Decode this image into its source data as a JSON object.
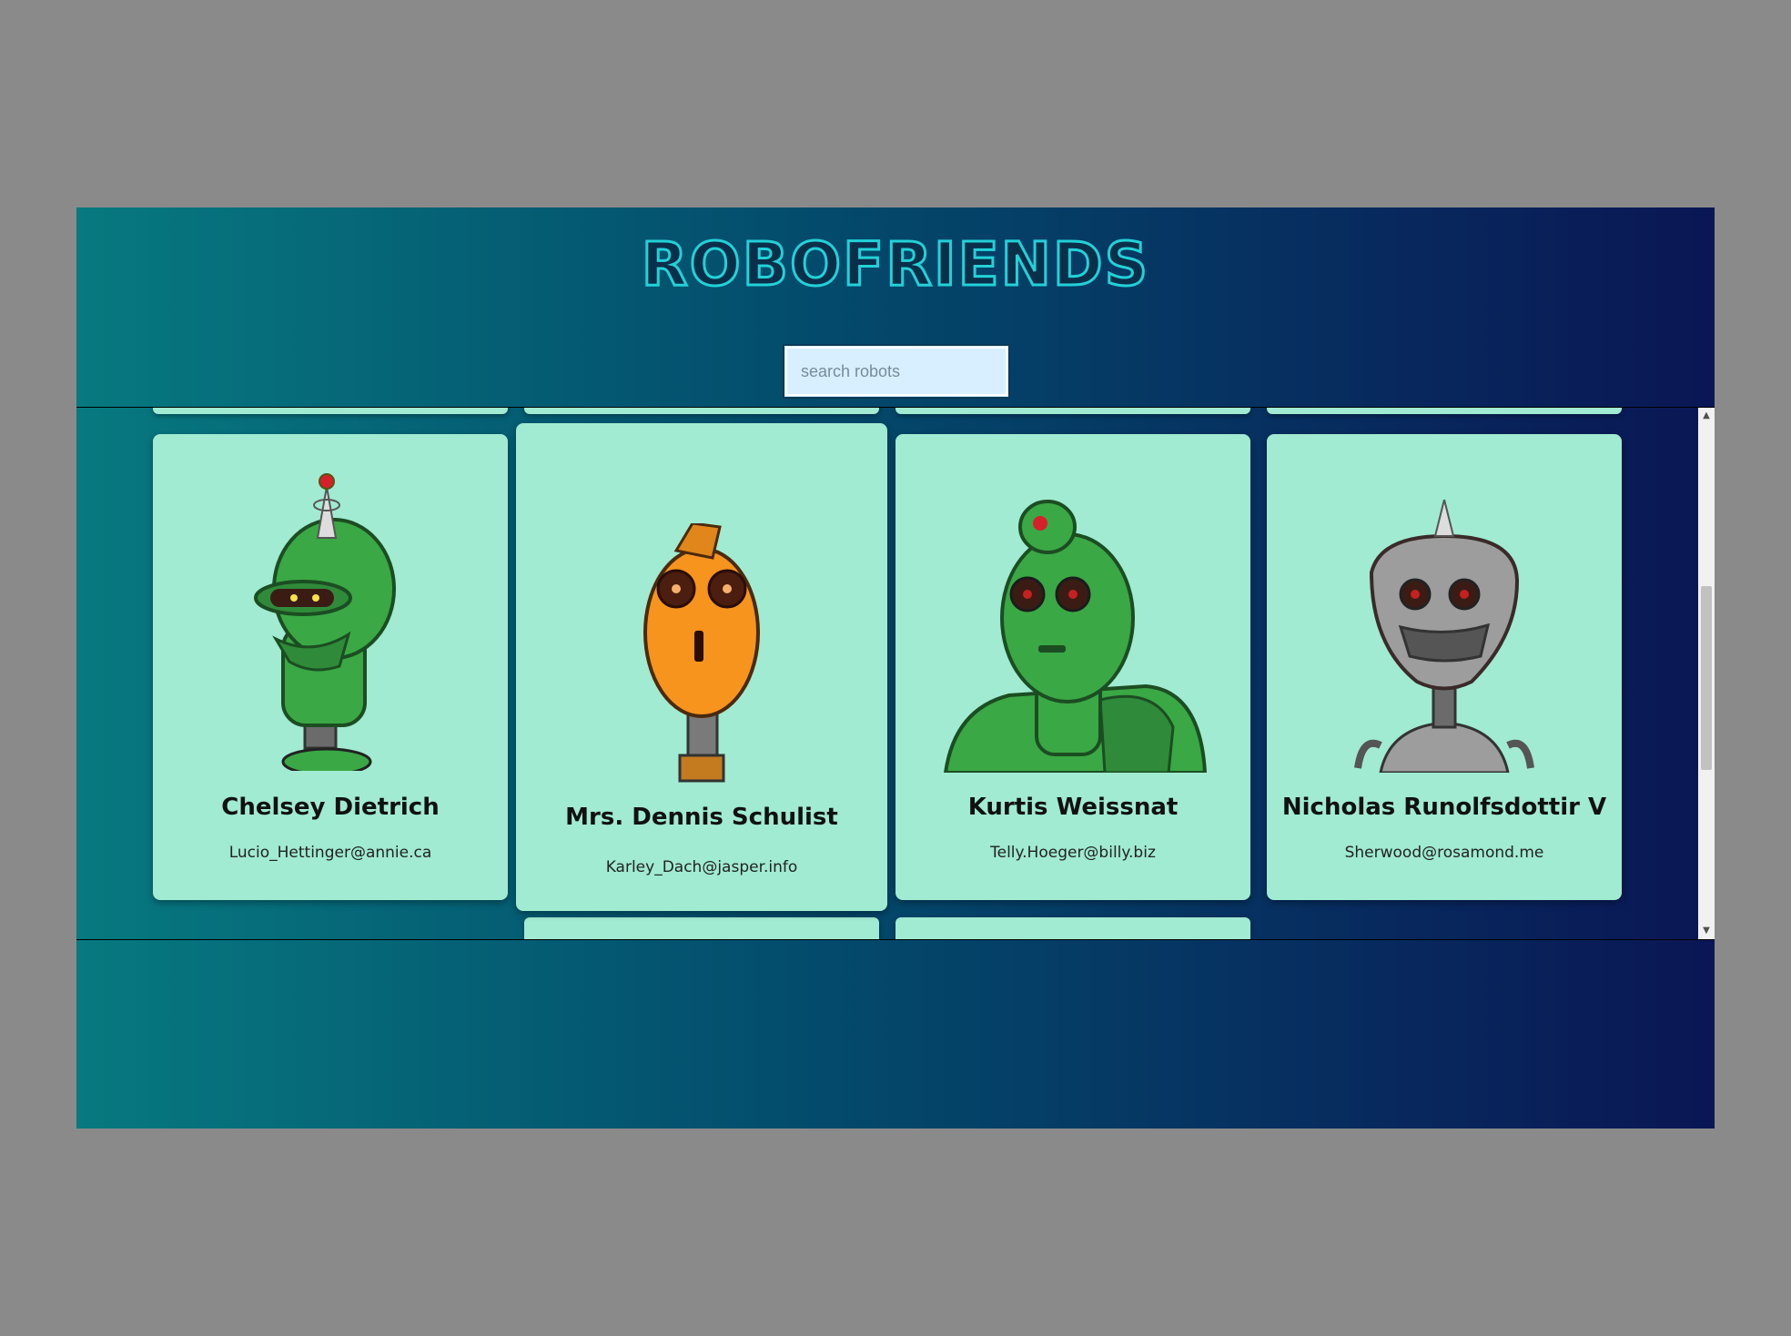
{
  "app": {
    "title": "ROBOFRIENDS"
  },
  "search": {
    "placeholder": "search robots",
    "value": ""
  },
  "robots": [
    {
      "name": "Chelsey Dietrich",
      "email": "Lucio_Hettinger@annie.ca",
      "avatar": "green-robot-antenna-icon"
    },
    {
      "name": "Mrs. Dennis Schulist",
      "email": "Karley_Dach@jasper.info",
      "avatar": "orange-robot-icon"
    },
    {
      "name": "Kurtis Weissnat",
      "email": "Telly.Hoeger@billy.biz",
      "avatar": "green-robot-dome-icon"
    },
    {
      "name": "Nicholas Runolfsdottir V",
      "email": "Sherwood@rosamond.me",
      "avatar": "gray-robot-spike-icon"
    }
  ],
  "colors": {
    "card": "#a0ebd2",
    "title": "#22d1d8",
    "gradient_start": "#07797f",
    "gradient_end": "#0a1655"
  }
}
